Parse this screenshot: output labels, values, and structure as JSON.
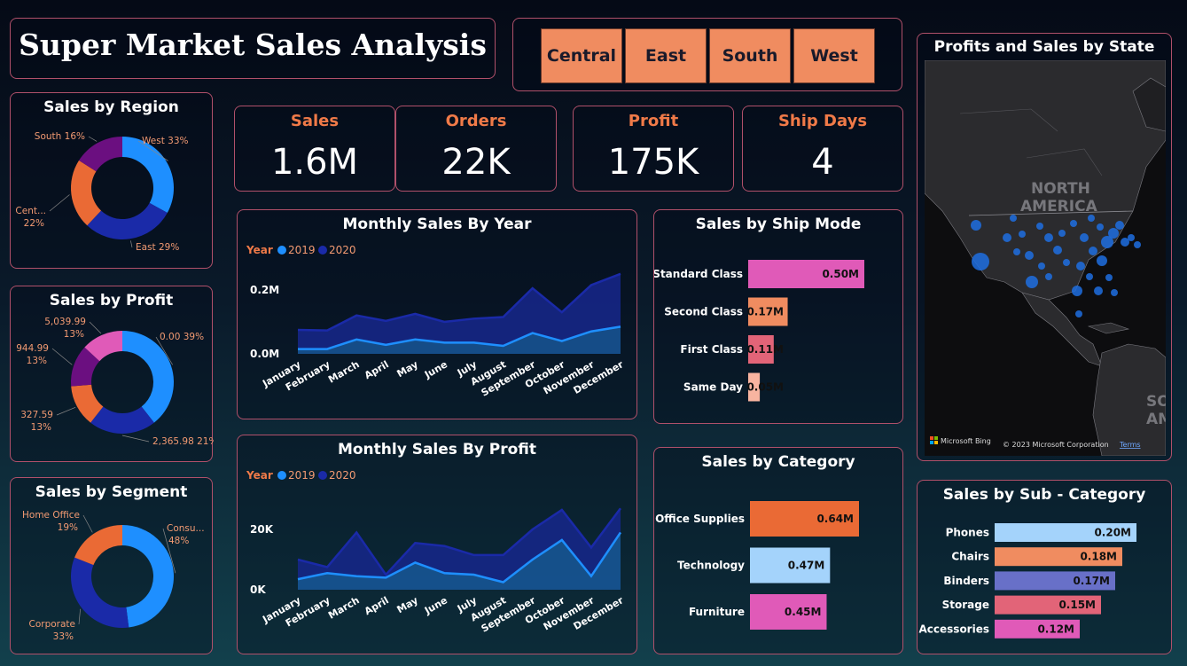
{
  "header": {
    "title": "Super Market Sales Analysis"
  },
  "region_slicer": [
    "Central",
    "East",
    "South",
    "West"
  ],
  "kpis": [
    {
      "label": "Sales",
      "value": "1.6M"
    },
    {
      "label": "Orders",
      "value": "22K"
    },
    {
      "label": "Profit",
      "value": "175K"
    },
    {
      "label": "Ship Days",
      "value": "4"
    }
  ],
  "colors": {
    "blue": "#1e8fff",
    "navy": "#1a2aa8",
    "orange": "#ea6a35",
    "purple": "#6b0f80",
    "pink": "#e05ab8",
    "peach": "#f08c60",
    "lightblue": "#a4d3fb",
    "violet": "#6870c8",
    "rose": "#e26478",
    "salmon": "#f8b4a0",
    "accent": "#f07a48"
  },
  "map": {
    "title": "Profits and Sales by State",
    "label1": "NORTH",
    "label2": "AMERICA",
    "label3": "SOU",
    "label4": "AME",
    "bing": "Microsoft Bing",
    "copyright": "© 2023 Microsoft Corporation",
    "terms": "Terms"
  },
  "chart_data": [
    {
      "id": "sales_by_region",
      "type": "pie",
      "title": "Sales by Region",
      "slices": [
        {
          "name": "West",
          "value": 33,
          "label": "West 33%",
          "color": "#1e8fff"
        },
        {
          "name": "East",
          "value": 29,
          "label": "East 29%",
          "color": "#1a2aa8"
        },
        {
          "name": "Central",
          "value": 22,
          "label": "Cent...",
          "label2": "22%",
          "color": "#ea6a35"
        },
        {
          "name": "South",
          "value": 16,
          "label": "South 16%",
          "color": "#6b0f80"
        }
      ]
    },
    {
      "id": "sales_by_profit",
      "type": "pie",
      "title": "Sales by Profit",
      "slices": [
        {
          "name": "0.00",
          "value": 39,
          "label": "0.00 39%",
          "color": "#1e8fff"
        },
        {
          "name": "2,365.98",
          "value": 21,
          "label": "2,365.98 21%",
          "color": "#1a2aa8"
        },
        {
          "name": "327.59",
          "value": 13,
          "label": "327.59",
          "label2": "13%",
          "color": "#ea6a35"
        },
        {
          "name": "944.99",
          "value": 13,
          "label": "944.99",
          "label2": "13%",
          "color": "#6b0f80"
        },
        {
          "name": "5,039.99",
          "value": 13,
          "label": "5,039.99",
          "label2": "13%",
          "color": "#e05ab8"
        }
      ]
    },
    {
      "id": "sales_by_segment",
      "type": "pie",
      "title": "Sales by Segment",
      "slices": [
        {
          "name": "Consumer",
          "value": 48,
          "label": "Consu...",
          "label2": "48%",
          "color": "#1e8fff"
        },
        {
          "name": "Corporate",
          "value": 33,
          "label": "Corporate",
          "label2": "33%",
          "color": "#1a2aa8"
        },
        {
          "name": "Home Office",
          "value": 19,
          "label": "Home Office",
          "label2": "19%",
          "color": "#ea6a35"
        }
      ]
    },
    {
      "id": "monthly_sales_by_year",
      "type": "area",
      "title": "Monthly Sales By Year",
      "legend_title": "Year",
      "categories": [
        "January",
        "February",
        "March",
        "April",
        "May",
        "June",
        "July",
        "August",
        "September",
        "October",
        "November",
        "December"
      ],
      "series": [
        {
          "name": "2019",
          "values": [
            15000,
            15000,
            45000,
            28000,
            45000,
            35000,
            35000,
            25000,
            65000,
            40000,
            70000,
            85000
          ],
          "color": "#1e8fff"
        },
        {
          "name": "2020",
          "values": [
            60000,
            58000,
            75000,
            75000,
            80000,
            65000,
            75000,
            90000,
            140000,
            90000,
            145000,
            165000
          ],
          "color": "#1a2aa8"
        }
      ],
      "stacked": true,
      "yticks": [
        {
          "v": 0,
          "label": "0.0M"
        },
        {
          "v": 200000,
          "label": "0.2M"
        }
      ],
      "ylim": [
        0,
        255000
      ]
    },
    {
      "id": "monthly_sales_by_profit",
      "type": "area",
      "title": "Monthly Sales By Profit",
      "legend_title": "Year",
      "categories": [
        "January",
        "February",
        "March",
        "April",
        "May",
        "June",
        "July",
        "August",
        "September",
        "October",
        "November",
        "December"
      ],
      "series": [
        {
          "name": "2019",
          "values": [
            3500,
            5500,
            4500,
            4000,
            9000,
            5500,
            5000,
            2500,
            10000,
            16500,
            4500,
            19000
          ],
          "color": "#1e8fff"
        },
        {
          "name": "2020",
          "values": [
            6500,
            2000,
            14500,
            1000,
            6500,
            9000,
            6500,
            9000,
            10000,
            10000,
            9500,
            8000
          ],
          "color": "#1a2aa8"
        }
      ],
      "stacked": true,
      "yticks": [
        {
          "v": 0,
          "label": "0K"
        },
        {
          "v": 20000,
          "label": "20K"
        }
      ],
      "ylim": [
        0,
        30000
      ]
    },
    {
      "id": "sales_by_ship_mode",
      "type": "bar",
      "title": "Sales by Ship Mode",
      "categories": [
        "Standard Class",
        "Second Class",
        "First Class",
        "Same Day"
      ],
      "values": [
        0.5,
        0.17,
        0.11,
        0.05
      ],
      "labels": [
        "0.50M",
        "0.17M",
        "0.11M",
        "0.05M"
      ],
      "colors": [
        "#e05ab8",
        "#f08c60",
        "#e26478",
        "#f8b4a0"
      ]
    },
    {
      "id": "sales_by_category",
      "type": "bar",
      "title": "Sales by Category",
      "categories": [
        "Office Supplies",
        "Technology",
        "Furniture"
      ],
      "values": [
        0.64,
        0.47,
        0.45
      ],
      "labels": [
        "0.64M",
        "0.47M",
        "0.45M"
      ],
      "colors": [
        "#ea6a35",
        "#a4d3fb",
        "#e05ab8"
      ]
    },
    {
      "id": "sales_by_sub_category",
      "type": "bar",
      "title": "Sales by Sub - Category",
      "categories": [
        "Phones",
        "Chairs",
        "Binders",
        "Storage",
        "Accessories"
      ],
      "values": [
        0.2,
        0.18,
        0.17,
        0.15,
        0.12
      ],
      "labels": [
        "0.20M",
        "0.18M",
        "0.17M",
        "0.15M",
        "0.12M"
      ],
      "colors": [
        "#a4d3fb",
        "#f08c60",
        "#6870c8",
        "#e26478",
        "#e05ab8"
      ]
    }
  ]
}
